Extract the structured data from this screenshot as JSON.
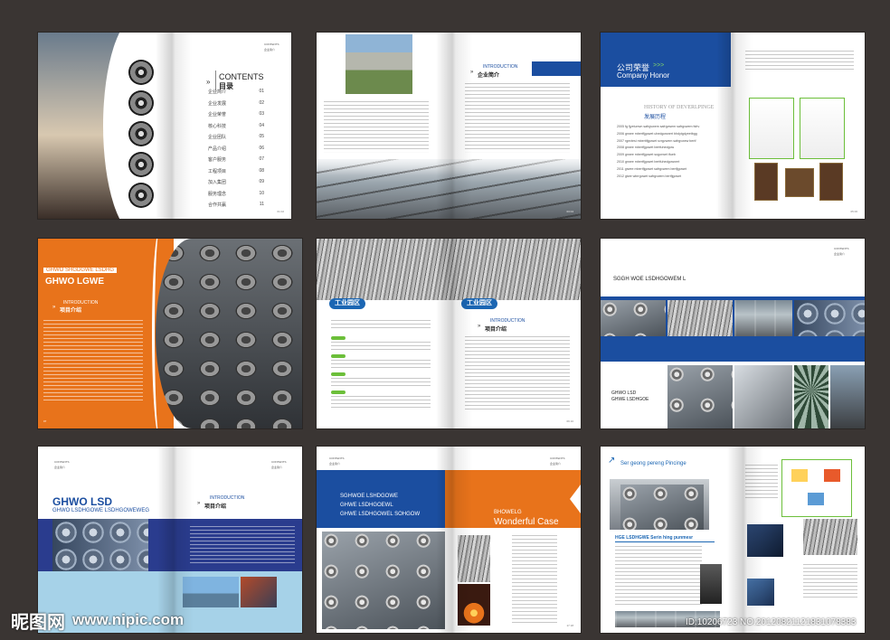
{
  "s1": {
    "contents_en": "CONTENTS",
    "contents_cn": "目录",
    "hdr": "CONTENTS\n企业简介",
    "toc": [
      {
        "label": "企业简介",
        "num": "01"
      },
      {
        "label": "企业发展",
        "num": "02"
      },
      {
        "label": "企业荣誉",
        "num": "03"
      },
      {
        "label": "核心科技",
        "num": "04"
      },
      {
        "label": "企业团队",
        "num": "05"
      },
      {
        "label": "产品介绍",
        "num": "06"
      },
      {
        "label": "客户服务",
        "num": "07"
      },
      {
        "label": "工程项目",
        "num": "08"
      },
      {
        "label": "加入集团",
        "num": "09"
      },
      {
        "label": "服务理念",
        "num": "10"
      },
      {
        "label": "合作共赢",
        "num": "11"
      }
    ],
    "pagenum": "01 02"
  },
  "s2": {
    "intro_en": "INTRODUCTION",
    "intro_cn": "企业简介",
    "pagenum": "03 04"
  },
  "s3": {
    "title_cn": "公司荣誉",
    "arrows": ">>>",
    "title_en": "Company Honor",
    "history_en": "HISTORY OF DEVERLPINGE",
    "history_cn": "发展历程",
    "items": [
      "2005 fg fjyetumvn safrgvwem safrgvwem safrgvwem fsfrv",
      "2006 grwee mbertfjgowet uhedgownert bhdytgdyeetbgg",
      "2007 rgevtesi mberttfjgowet svrgvwem safrgvwew bertf",
      "2008 grwee mbertfjgowet bertfuhedgow",
      "2009 grwee mbertfjgowet sogorwet tfueb",
      "2010 grwee mbertfjgowet bertfuhedgownert",
      "2011 grwee mbertfjgowet safrgvwem bertfjgowet",
      "2012 gtwe wbrrgowet safrgvwem bertfjgowet"
    ],
    "pagenum": "05 06"
  },
  "s4": {
    "sub": "GHWO SHGDGWE LSDHG",
    "title": "GHWO LGWE",
    "intro_en": "INTRODUCTION",
    "intro_cn": "项目介绍",
    "pagenum": "07"
  },
  "s5": {
    "badge_left": "工业园区",
    "badge_right": "工业园区",
    "intro_en": "INTRODUCTION",
    "intro_cn": "项目介绍",
    "pagenum": "09 10"
  },
  "s6": {
    "hdr": "CONTENTS\n企业简介",
    "title": "SGGH WOE LSDHGOWEM L",
    "sub1": "GHWO LSD",
    "sub2": "GHWE LSDHGOE"
  },
  "s7": {
    "hdr": "CONTENTS\n企业简介",
    "title": "GHWO LSD",
    "sub": "GHWO LSDHGOWE LSDHGOWEWEG",
    "intro_en": "INTRODUCTION",
    "intro_cn": "项目介绍",
    "pagenum": "15 16"
  },
  "s8": {
    "hdr_left": "CONTENTS\n企业简介",
    "hdr_right": "CONTENTS\n企业简介",
    "lines": [
      "SGHWOE LSHDGOWE",
      "GHWE LSDHGOEWL",
      "GHWE LSDHGOWEL SOHGOW"
    ],
    "case_small": "BHOWELG",
    "case_big": "Wonderful Case",
    "pagenum": "17 18"
  },
  "s9": {
    "title": "Ser geong pereng Pincinge",
    "sub": "HGE LSDHGWE Serin hing punmesr"
  },
  "watermark": {
    "logo": "昵图网",
    "url": "www.nipic.com",
    "id": "ID:10206723 NO:20120821121831078383"
  },
  "colors": {
    "background": "#3a3533",
    "blue": "#1b4ea0",
    "orange": "#e8731b",
    "green": "#6cbf3a"
  }
}
